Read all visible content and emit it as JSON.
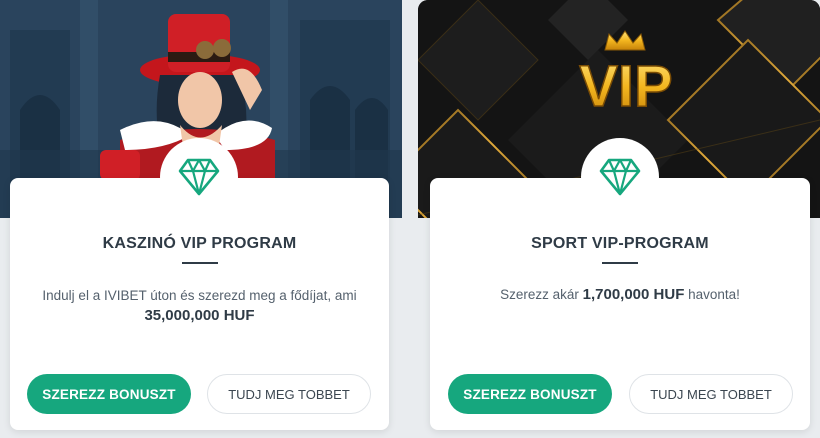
{
  "cards": [
    {
      "title": "KASZINÓ VIP PROGRAM",
      "desc_line": "Indulj el a IVIBET úton és szerezd meg a fődíjat, ami",
      "desc_amount": "35,000,000 HUF",
      "primary_label": "SZEREZZ BONUSZT",
      "secondary_label": "TUDJ MEG TOBBET"
    },
    {
      "title": "SPORT VIP-PROGRAM",
      "desc_prefix": "Szerezz akár",
      "desc_amount": "1,700,000 HUF",
      "desc_suffix": "havonta!",
      "primary_label": "SZEREZZ BONUSZT",
      "secondary_label": "TUDJ MEG TOBBET"
    }
  ],
  "hero_logo": "VIP",
  "icons": {
    "badge": "diamond-icon",
    "crown": "crown-icon"
  },
  "colors": {
    "accent": "#16a77e",
    "title": "#2f3b46",
    "gold": "#f3b61f"
  }
}
